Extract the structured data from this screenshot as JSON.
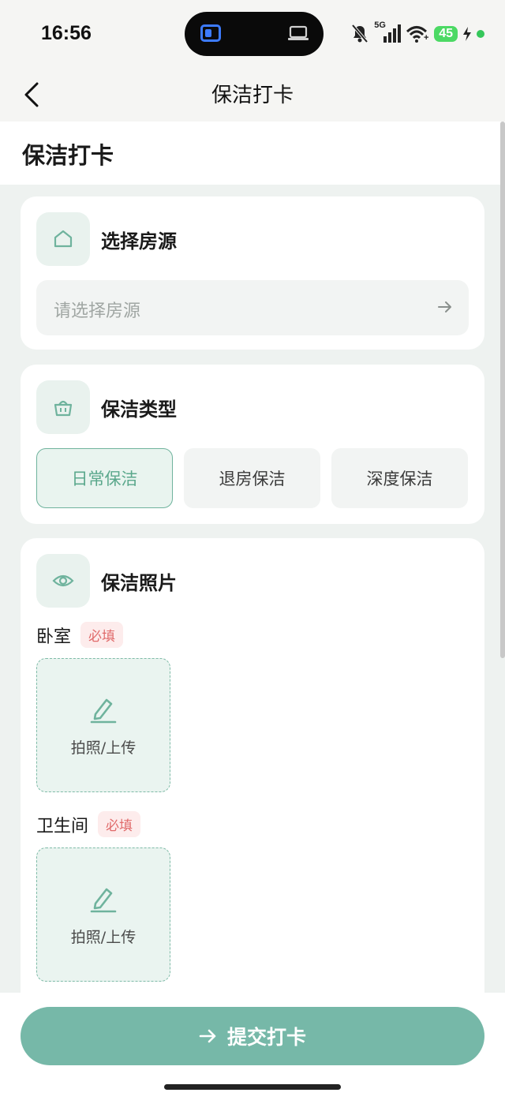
{
  "status_bar": {
    "time": "16:56",
    "battery": "45",
    "network": "5G"
  },
  "nav": {
    "title": "保洁打卡"
  },
  "page": {
    "heading": "保洁打卡"
  },
  "house_section": {
    "title": "选择房源",
    "placeholder": "请选择房源",
    "icon": "home-icon"
  },
  "type_section": {
    "title": "保洁类型",
    "icon": "basket-icon",
    "options": [
      "日常保洁",
      "退房保洁",
      "深度保洁"
    ],
    "selected": "日常保洁"
  },
  "photo_section": {
    "title": "保洁照片",
    "icon": "eye-icon",
    "groups": [
      {
        "label": "卧室",
        "required": "必填",
        "upload_text": "拍照/上传"
      },
      {
        "label": "卫生间",
        "required": "必填",
        "upload_text": "拍照/上传"
      }
    ]
  },
  "submit": {
    "label": "提交打卡"
  },
  "colors": {
    "accent": "#76b8a8",
    "accent_dark": "#5ba88c",
    "required": "#e06a6a"
  }
}
